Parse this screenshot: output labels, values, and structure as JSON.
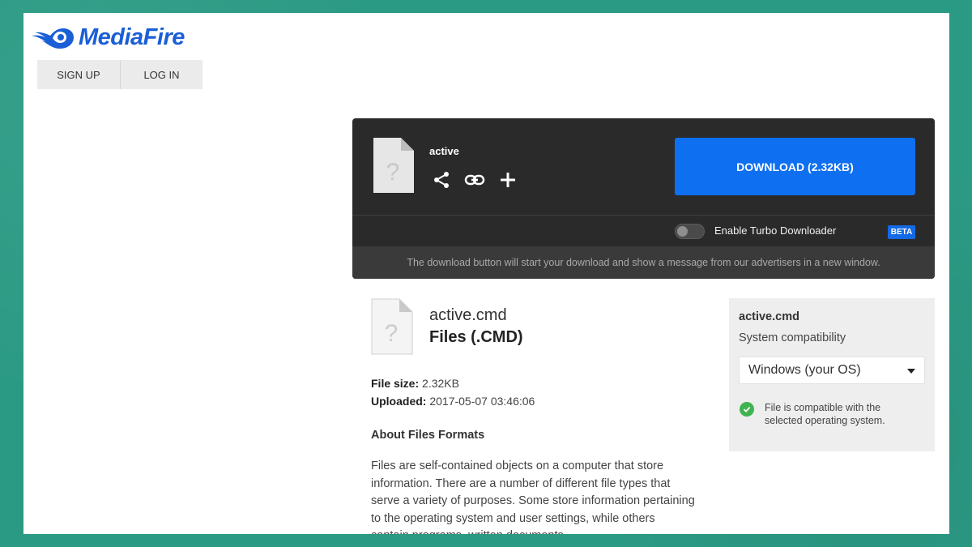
{
  "brand": {
    "name": "MediaFire",
    "color": "#1a5fd6"
  },
  "auth": {
    "signup_label": "SIGN UP",
    "login_label": "LOG IN"
  },
  "download_panel": {
    "filename": "active",
    "actions": [
      {
        "icon": "share-icon"
      },
      {
        "icon": "link-icon"
      },
      {
        "icon": "plus-icon"
      }
    ],
    "download_label": "DOWNLOAD (2.32KB)",
    "turbo_label": "Enable Turbo Downloader",
    "turbo_enabled": false,
    "beta_label": "BETA",
    "note": "The download button will start your download and show a message from our advertisers in a new window.",
    "accent_color": "#0e6ff0"
  },
  "file": {
    "name": "active.cmd",
    "type": "Files (.CMD)",
    "size_label": "File size:",
    "size_value": "2.32KB",
    "uploaded_label": "Uploaded:",
    "uploaded_value": "2017-05-07 03:46:06",
    "about_title": "About Files Formats",
    "about_text": "Files are self-contained objects on a computer that store information. There are a number of different file types that serve a variety of purposes. Some store information pertaining to the operating system and user settings, while others contain programs, written documents,"
  },
  "compat": {
    "name": "active.cmd",
    "label": "System compatibility",
    "os_selected": "Windows (your OS)",
    "message": "File is compatible with the selected operating system.",
    "ok_color": "#3fb34f"
  }
}
